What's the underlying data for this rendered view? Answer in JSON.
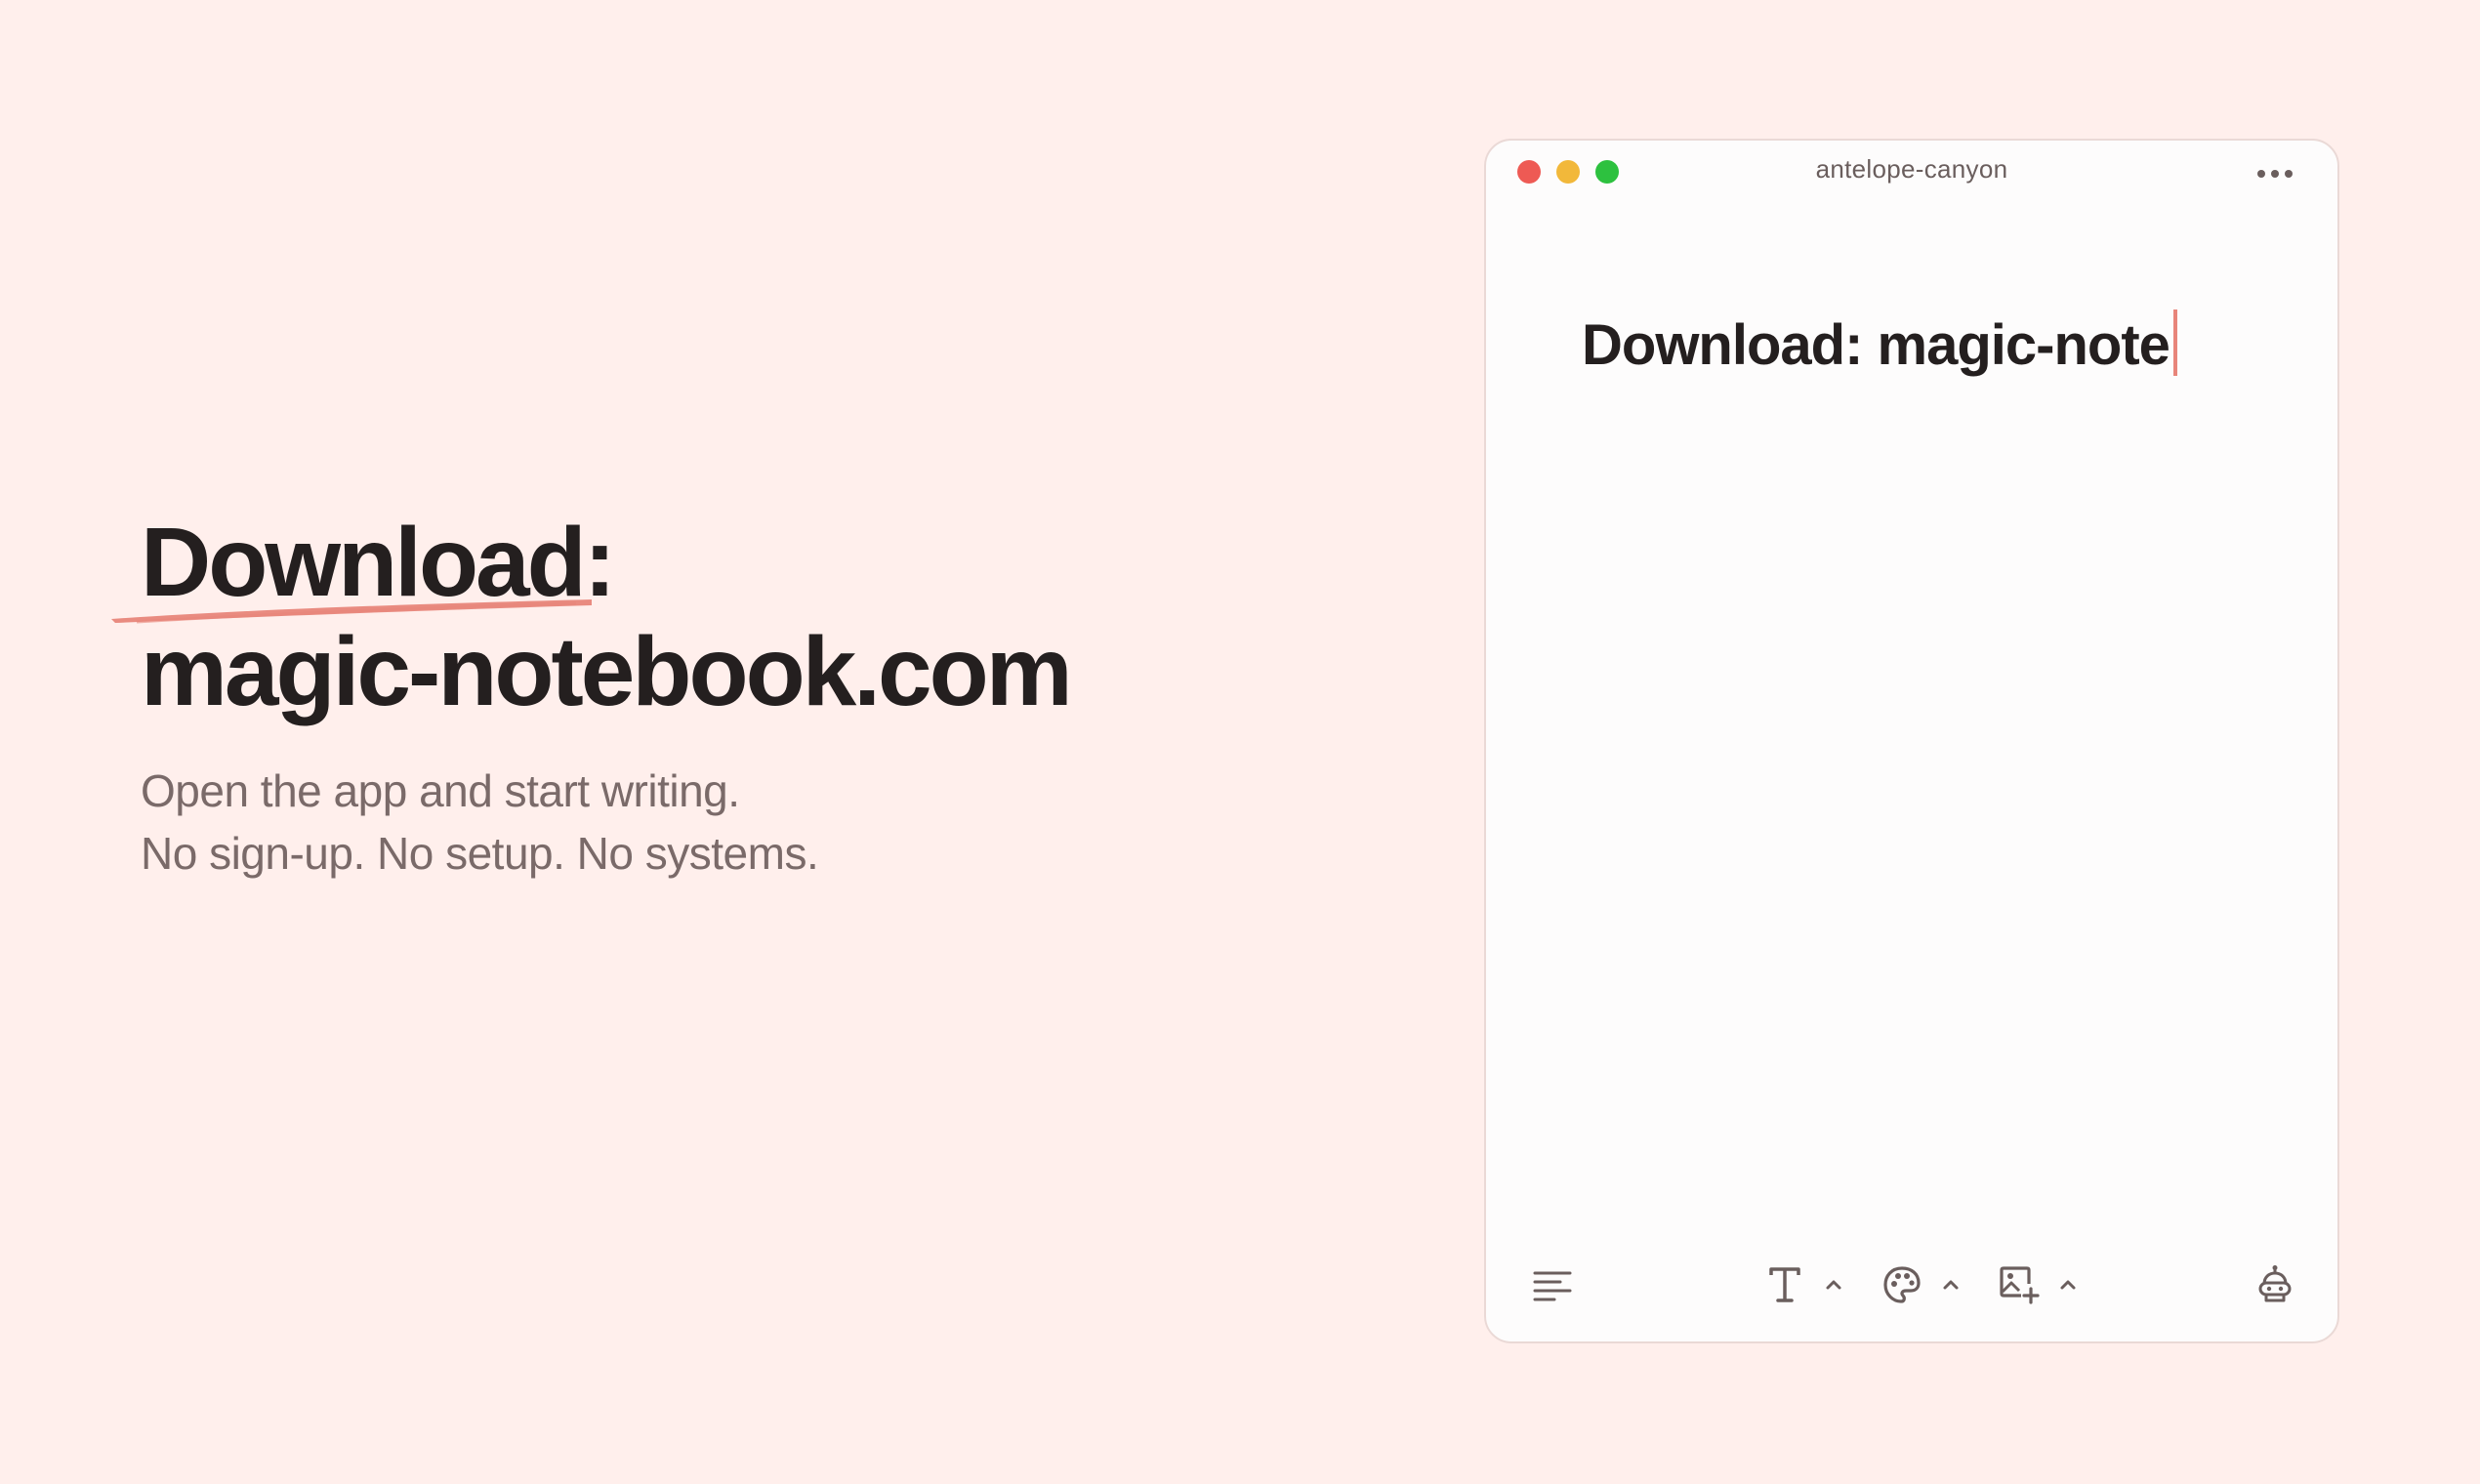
{
  "hero": {
    "title_line1": "Download:",
    "title_line2": "magic-notebook.com",
    "subtitle_line1": "Open the app and start writing.",
    "subtitle_line2": "No sign-up. No setup. No systems."
  },
  "window": {
    "title": "antelope-canyon",
    "editor_text": "Download: magic-note"
  },
  "icons": {
    "more": "more-horizontal-icon",
    "outline": "outline-lines-icon",
    "text_format": "text-format-icon",
    "palette": "palette-icon",
    "image_add": "image-add-icon",
    "chevron": "chevron-up-icon",
    "assistant": "robot-assistant-icon"
  },
  "colors": {
    "background": "#ffefec",
    "accent": "#e8857a",
    "text_primary": "#241f1f",
    "text_secondary": "#7a6a69",
    "traffic_close": "#ee5a54",
    "traffic_minimize": "#f2b83a",
    "traffic_maximize": "#2dc13f"
  }
}
